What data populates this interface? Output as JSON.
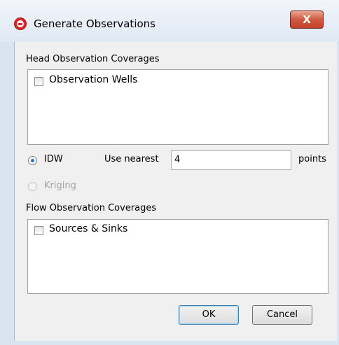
{
  "window": {
    "title": "Generate Observations",
    "close_label": "X"
  },
  "head_group": {
    "label": "Head Observation Coverages",
    "items": [
      {
        "label": "Observation Wells",
        "checked": false
      }
    ]
  },
  "interpolation": {
    "idw_label": "IDW",
    "idw_selected": true,
    "use_nearest_label": "Use nearest",
    "nearest_value": "4",
    "points_label": "points",
    "kriging_label": "Kriging",
    "kriging_enabled": false
  },
  "flow_group": {
    "label": "Flow Observation Coverages",
    "items": [
      {
        "label": "Sources & Sinks",
        "checked": false
      }
    ]
  },
  "buttons": {
    "ok_label": "OK",
    "cancel_label": "Cancel"
  }
}
